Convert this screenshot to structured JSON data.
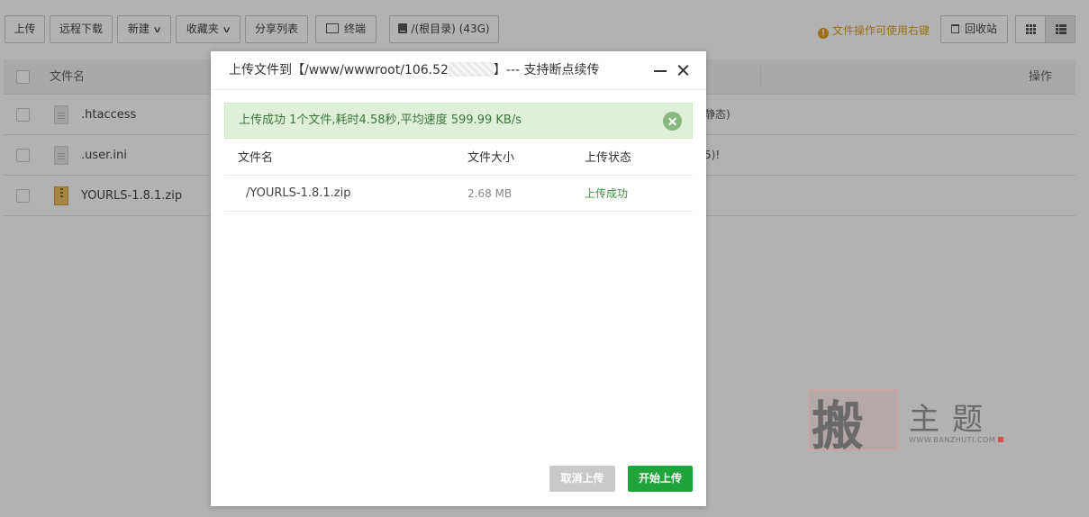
{
  "toolbar": {
    "upload_label": "上传",
    "remote_download_label": "远程下载",
    "new_label": "新建",
    "favorites_label": "收藏夹",
    "share_list_label": "分享列表",
    "terminal_label": "终端",
    "disk_label": "/(根目录) (43G)",
    "tip_text": "文件操作可使用右键",
    "recycle_label": "回收站",
    "chevron_glyph": "∨"
  },
  "file_table": {
    "col_name": "文件名",
    "col_actions": "操作",
    "rows": [
      {
        "name": ".htaccess",
        "trail": "静态)",
        "icon": "file-icon"
      },
      {
        "name": ".user.ini",
        "trail": "5)!",
        "icon": "file-icon"
      },
      {
        "name": "YOURLS-1.8.1.zip",
        "trail": "",
        "icon": "zip-icon"
      }
    ]
  },
  "dialog": {
    "title_prefix": "上传文件到【/www/wwwroot/106.52",
    "title_suffix": "】--- 支持断点续传",
    "alert_text": "上传成功 1个文件,耗时4.58秒,平均速度 599.99 KB/s",
    "columns": {
      "name": "文件名",
      "size": "文件大小",
      "status": "上传状态"
    },
    "files": [
      {
        "name": "/YOURLS-1.8.1.zip",
        "size": "2.68 MB",
        "status": "上传成功"
      }
    ],
    "cancel_label": "取消上传",
    "start_label": "开始上传"
  },
  "watermark": {
    "seal_char": "搬",
    "title": "主题",
    "url": "WWW.BANZHUTI.COM"
  },
  "colors": {
    "accent_green": "#20a53a",
    "tip_orange": "#e3a027",
    "alert_bg": "#dff0d8",
    "alert_text": "#3c763d"
  }
}
